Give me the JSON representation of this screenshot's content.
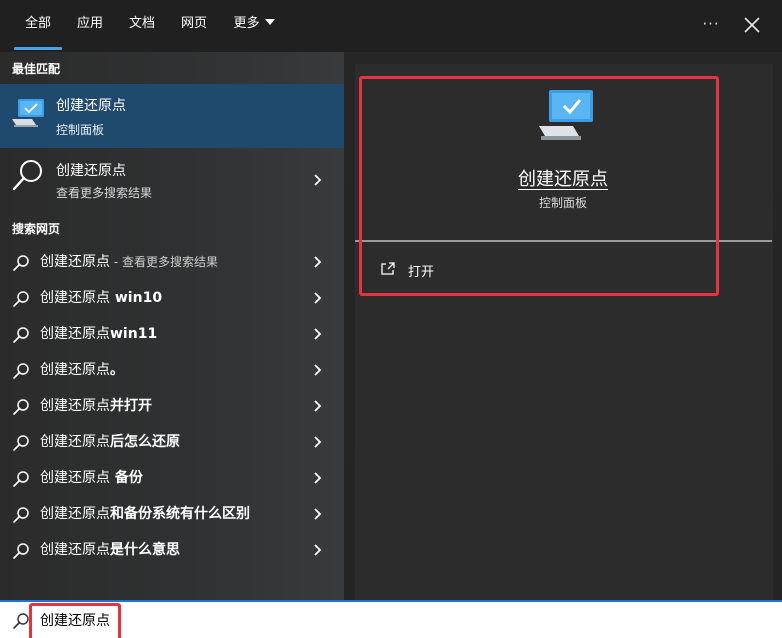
{
  "tabs": [
    {
      "label": "全部",
      "active": true
    },
    {
      "label": "应用",
      "active": false
    },
    {
      "label": "文档",
      "active": false
    },
    {
      "label": "网页",
      "active": false
    },
    {
      "label": "更多",
      "active": false
    }
  ],
  "topbar": {
    "more_options_label": "···"
  },
  "left": {
    "best_match_label": "最佳匹配",
    "best_match": {
      "title": "创建还原点",
      "subtitle": "控制面板"
    },
    "more_results": {
      "title": "创建还原点",
      "subtitle": "查看更多搜索结果"
    },
    "search_web_label": "搜索网页",
    "web_items": [
      {
        "prefix": "创建还原点",
        "bold": "",
        "suffix": " - 查看更多搜索结果"
      },
      {
        "prefix": "创建还原点",
        "bold": " win10",
        "suffix": ""
      },
      {
        "prefix": "创建还原点",
        "bold": "win11",
        "suffix": ""
      },
      {
        "prefix": "创建还原点",
        "bold": "。",
        "suffix": ""
      },
      {
        "prefix": "创建还原点",
        "bold": "并打开",
        "suffix": ""
      },
      {
        "prefix": "创建还原点",
        "bold": "后怎么还原",
        "suffix": ""
      },
      {
        "prefix": "创建还原点",
        "bold": " 备份",
        "suffix": ""
      },
      {
        "prefix": "创建还原点",
        "bold": "和备份系统有什么区别",
        "suffix": ""
      },
      {
        "prefix": "创建还原点",
        "bold": "是什么意思",
        "suffix": ""
      }
    ]
  },
  "right": {
    "title": "创建还原点",
    "subtitle": "控制面板",
    "actions": [
      {
        "label": "打开"
      }
    ]
  },
  "search": {
    "value": "创建还原点"
  },
  "colors": {
    "accent": "#4aa3e8",
    "highlight": "#1f4a6e",
    "annotation_red": "#e5343f",
    "search_border": "#1a73d9"
  }
}
